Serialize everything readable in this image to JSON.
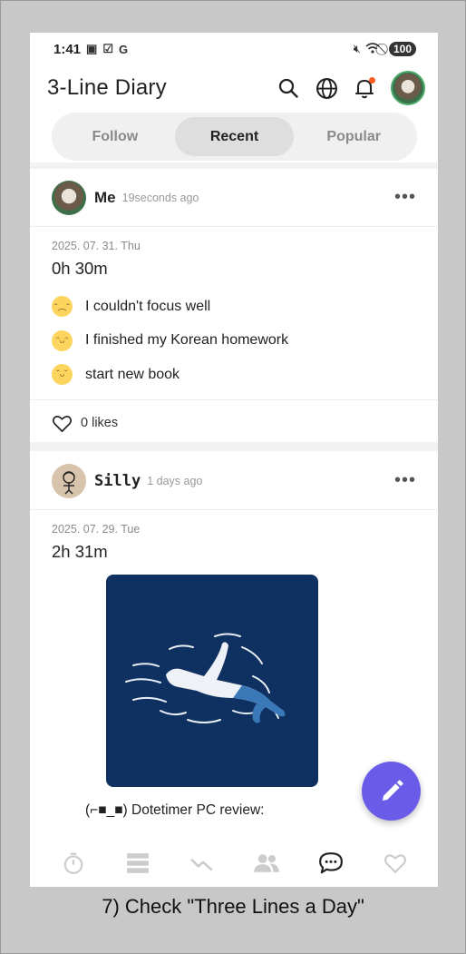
{
  "status_bar": {
    "time": "1:41",
    "carrier_icon": "G",
    "battery": "100"
  },
  "header": {
    "title": "3-Line Diary"
  },
  "tabs": [
    {
      "label": "Follow",
      "active": false
    },
    {
      "label": "Recent",
      "active": true
    },
    {
      "label": "Popular",
      "active": false
    }
  ],
  "posts": [
    {
      "author": "Me",
      "ago": "19seconds ago",
      "more": "•••",
      "date": "2025. 07. 31. Thu",
      "duration": "0h 30m",
      "lines": [
        {
          "text": "I couldn't focus well",
          "emoji": "frown-face"
        },
        {
          "text": "I finished my Korean homework",
          "emoji": "smile-face"
        },
        {
          "text": "start new book",
          "emoji": "happy-face"
        }
      ],
      "likes": "0 likes"
    },
    {
      "author": "Silly",
      "ago": "1 days ago",
      "more": "•••",
      "date": "2025. 07. 29. Tue",
      "duration": "2h 31m",
      "caption": "(⌐■_■) Dotetimer PC review:"
    }
  ],
  "bottom_nav": [
    "timer-icon",
    "list-icon",
    "chart-icon",
    "people-icon",
    "chat-icon",
    "heart-icon"
  ],
  "footer_caption": "7) Check \"Three Lines a Day\"",
  "colors": {
    "fab": "#6a5ce8",
    "notification": "#ff5a1f",
    "emoji": "#fcd45e",
    "image_bg": "#0f3161"
  }
}
